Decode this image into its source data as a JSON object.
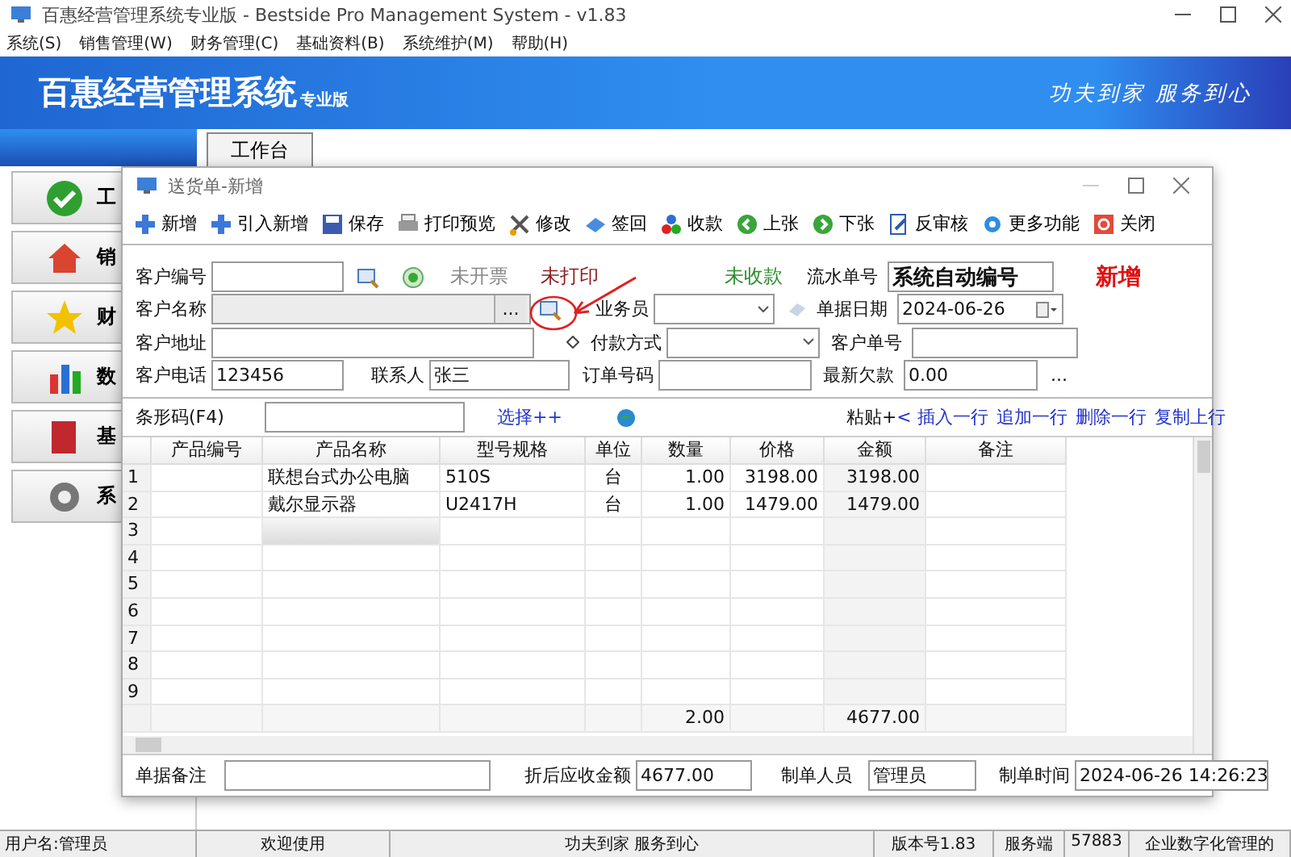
{
  "app": {
    "title": "百惠经营管理系统专业版 - Bestside Pro Management System - v1.83"
  },
  "menu": [
    {
      "label": "系统(S)"
    },
    {
      "label": "销售管理(W)"
    },
    {
      "label": "财务管理(C)"
    },
    {
      "label": "基础资料(B)"
    },
    {
      "label": "系统维护(M)"
    },
    {
      "label": "帮助(H)"
    }
  ],
  "banner": {
    "title": "百惠经营管理系统",
    "edition": "专业版",
    "slogan": "功夫到家 服务到心"
  },
  "tabs": [
    {
      "label": "工作台",
      "selected": true
    }
  ],
  "sidebar": {
    "items": [
      {
        "label": "工"
      },
      {
        "label": "销"
      },
      {
        "label": "财"
      },
      {
        "label": "数"
      },
      {
        "label": "基"
      },
      {
        "label": "系"
      }
    ]
  },
  "dialog": {
    "title": "送货单-新增",
    "toolbar": [
      {
        "label": "新增"
      },
      {
        "label": "引入新增"
      },
      {
        "label": "保存"
      },
      {
        "label": "打印预览"
      },
      {
        "label": "修改"
      },
      {
        "label": "签回"
      },
      {
        "label": "收款"
      },
      {
        "label": "上张"
      },
      {
        "label": "下张"
      },
      {
        "label": "反审核"
      },
      {
        "label": "更多功能"
      },
      {
        "label": "关闭"
      }
    ],
    "form": {
      "customer_code": {
        "label": "客户编号"
      },
      "invoice_status": "未开票",
      "print_status": "未打印",
      "payment_status": "未收款",
      "serial_number": {
        "label": "流水单号",
        "value": "系统自动编号"
      },
      "mode": "新增",
      "customer_name": {
        "label": "客户名称",
        "button": "..."
      },
      "salesperson": {
        "label": "业务员"
      },
      "doc_date": {
        "label": "单据日期",
        "value": "2024-06-26"
      },
      "customer_address": {
        "label": "客户地址"
      },
      "payment_method": {
        "label": "付款方式"
      },
      "customer_doc_no": {
        "label": "客户单号"
      },
      "customer_phone": {
        "label": "客户电话",
        "value": "123456"
      },
      "contact": {
        "label": "联系人",
        "value": "张三"
      },
      "order_number": {
        "label": "订单号码"
      },
      "latest_debt": {
        "label": "最新欠款",
        "value": "0.00",
        "button": "..."
      }
    },
    "barcode": {
      "label": "条形码(F4)",
      "select_link": "选择++",
      "paste": "粘贴+",
      "actions": [
        {
          "label": "< 插入一行"
        },
        {
          "label": "追加一行"
        },
        {
          "label": "删除一行"
        },
        {
          "label": "复制上行"
        }
      ]
    },
    "table": {
      "columns": [
        "产品编号",
        "产品名称",
        "型号规格",
        "单位",
        "数量",
        "价格",
        "金额",
        "备注"
      ],
      "rows": [
        {
          "number": "1",
          "name": "联想台式办公电脑",
          "model": "510S",
          "unit": "台",
          "qty": "1.00",
          "price": "3198.00",
          "amount": "3198.00",
          "editing": false
        },
        {
          "number": "2",
          "name": "戴尔显示器",
          "model": "U2417H",
          "unit": "台",
          "qty": "1.00",
          "price": "1479.00",
          "amount": "1479.00",
          "editing": false
        },
        {
          "number": "3",
          "editing": true
        },
        {
          "number": "4",
          "editing": false
        },
        {
          "number": "5",
          "editing": false
        },
        {
          "number": "6",
          "editing": false
        },
        {
          "number": "7",
          "editing": false
        },
        {
          "number": "8",
          "editing": false
        },
        {
          "number": "9",
          "editing": false
        }
      ],
      "totals": {
        "qty": "2.00",
        "amount": "4677.00"
      }
    },
    "footer": {
      "remark": {
        "label": "单据备注"
      },
      "receivable": {
        "label": "折后应收金额",
        "value": "4677.00"
      },
      "maker": {
        "label": "制单人员",
        "value": "管理员"
      },
      "made_at": {
        "label": "制单时间",
        "value": "2024-06-26 14:26:23"
      }
    }
  },
  "status_bar": [
    {
      "text": "用户名:管理员"
    },
    {
      "text": "欢迎使用"
    },
    {
      "text": "功夫到家 服务到心"
    },
    {
      "text": "版本号1.83"
    },
    {
      "text": "服务端"
    },
    {
      "text": "57883"
    },
    {
      "text": "企业数字化管理的"
    }
  ]
}
